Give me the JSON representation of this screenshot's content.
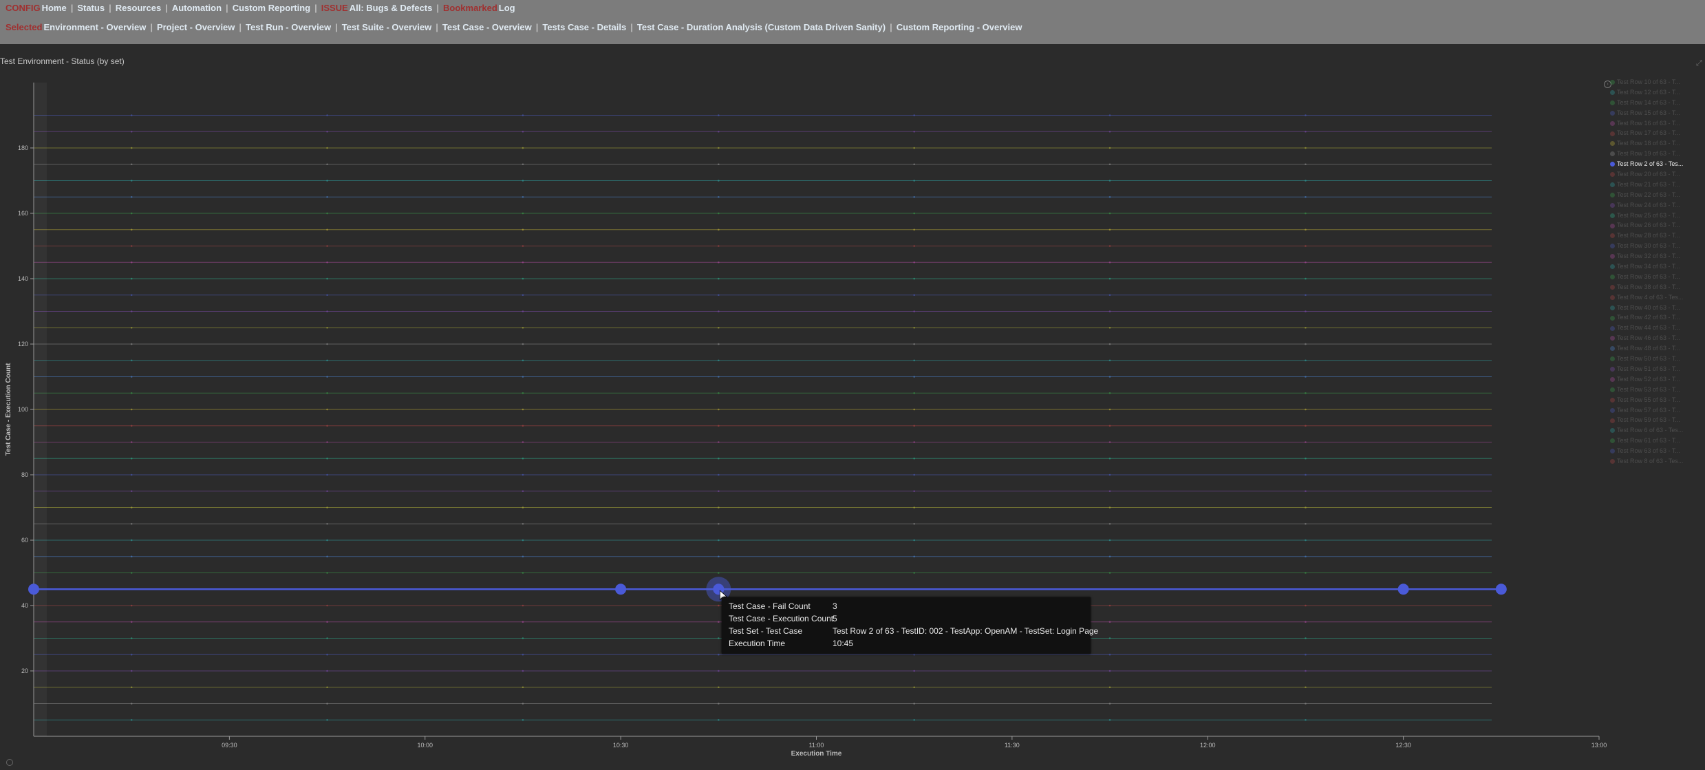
{
  "nav": {
    "row1": [
      {
        "tag": "CONFIG",
        "label": "Home"
      },
      {
        "label": "Status"
      },
      {
        "label": "Resources"
      },
      {
        "label": "Automation"
      },
      {
        "label": "Custom Reporting"
      },
      {
        "tag": "ISSUE",
        "label": "All: Bugs & Defects"
      },
      {
        "tag": "Bookmarked",
        "label": "Log"
      }
    ],
    "row2": [
      {
        "tag": "Selected",
        "label": "Environment - Overview"
      },
      {
        "label": "Project - Overview"
      },
      {
        "label": "Test Run - Overview"
      },
      {
        "label": "Test Suite - Overview"
      },
      {
        "label": "Test Case - Overview"
      },
      {
        "label": "Tests Case - Details"
      },
      {
        "label": "Test Case - Duration Analysis (Custom  Data Driven  Sanity)"
      },
      {
        "label": "Custom Reporting - Overview"
      }
    ]
  },
  "tooltip": {
    "rows": [
      {
        "key": "Test Case - Fail Count",
        "value": "3"
      },
      {
        "key": "Test Case - Execution Count",
        "value": "5"
      },
      {
        "key": "Test Set - Test Case",
        "value": "Test Row 2 of 63 - TestID: 002 - TestApp: OpenAM - TestSet: Login Page"
      },
      {
        "key": "Execution Time",
        "value": "10:45"
      }
    ]
  },
  "chart_data": {
    "type": "line",
    "title": "Test Environment - Status (by set)",
    "xlabel": "Execution Time",
    "ylabel": "Test Case - Execution Count",
    "x_ticks": [
      "09:30",
      "10:00",
      "10:30",
      "11:00",
      "11:30",
      "12:00",
      "12:30",
      "13:00"
    ],
    "x_range": [
      "09:00",
      "13:00"
    ],
    "y_ticks": [
      20,
      40,
      60,
      80,
      100,
      120,
      140,
      160,
      180
    ],
    "ylim": [
      0,
      200
    ],
    "grid": false,
    "legend_position": "right",
    "highlighted_series": "Test Row 2 of 63 - Tes...",
    "highlighted_series_points": {
      "x": [
        "09:00",
        "10:30",
        "10:45",
        "12:30",
        "12:45"
      ],
      "y": [
        45,
        45,
        45,
        45,
        45
      ]
    },
    "background_series_levels": [
      5,
      10,
      15,
      20,
      25,
      30,
      35,
      40,
      45,
      50,
      55,
      60,
      65,
      70,
      75,
      80,
      85,
      90,
      95,
      100,
      105,
      110,
      115,
      120,
      125,
      130,
      135,
      140,
      145,
      150,
      155,
      160,
      165,
      170,
      175,
      180,
      185,
      190
    ],
    "series_colors": [
      "#2e9c9c",
      "#8a8a8a",
      "#a8a838",
      "#7a4aa8",
      "#4a5ab8",
      "#2ea888",
      "#a84a9a",
      "#a84444",
      "#b8a838",
      "#3a9a4a",
      "#4a80c8"
    ],
    "legend": [
      {
        "label": "Test Row 10 of 63 - T...",
        "color": "#3a9a4a"
      },
      {
        "label": "Test Row 12 of 63 - T...",
        "color": "#2e9c9c"
      },
      {
        "label": "Test Row 14 of 63 - T...",
        "color": "#3a9a4a"
      },
      {
        "label": "Test Row 15 of 63 - T...",
        "color": "#4a5ab8"
      },
      {
        "label": "Test Row 16 of 63 - T...",
        "color": "#a84a9a"
      },
      {
        "label": "Test Row 17 of 63 - T...",
        "color": "#a84444"
      },
      {
        "label": "Test Row 18 of 63 - T...",
        "color": "#b8a838"
      },
      {
        "label": "Test Row 19 of 63 - T...",
        "color": "#8a8a8a"
      },
      {
        "label": "Test Row 2 of 63 - Tes...",
        "color": "#4a5ad8"
      },
      {
        "label": "Test Row 20 of 63 - T...",
        "color": "#a84444"
      },
      {
        "label": "Test Row 21 of 63 - T...",
        "color": "#2e9c9c"
      },
      {
        "label": "Test Row 22 of 63 - T...",
        "color": "#3a9a4a"
      },
      {
        "label": "Test Row 24 of 63 - T...",
        "color": "#7a4aa8"
      },
      {
        "label": "Test Row 25 of 63 - T...",
        "color": "#2ea888"
      },
      {
        "label": "Test Row 26 of 63 - T...",
        "color": "#a84a9a"
      },
      {
        "label": "Test Row 28 of 63 - T...",
        "color": "#a84444"
      },
      {
        "label": "Test Row 30 of 63 - T...",
        "color": "#4a5ab8"
      },
      {
        "label": "Test Row 32 of 63 - T...",
        "color": "#a84a9a"
      },
      {
        "label": "Test Row 34 of 63 - T...",
        "color": "#2e9c9c"
      },
      {
        "label": "Test Row 36 of 63 - T...",
        "color": "#3a9a4a"
      },
      {
        "label": "Test Row 38 of 63 - T...",
        "color": "#a84444"
      },
      {
        "label": "Test Row 4 of 63 - Tes...",
        "color": "#a84444"
      },
      {
        "label": "Test Row 40 of 63 - T...",
        "color": "#2e9c9c"
      },
      {
        "label": "Test Row 42 of 63 - T...",
        "color": "#3a9a4a"
      },
      {
        "label": "Test Row 44 of 63 - T...",
        "color": "#4a5ab8"
      },
      {
        "label": "Test Row 46 of 63 - T...",
        "color": "#a84a9a"
      },
      {
        "label": "Test Row 48 of 63 - T...",
        "color": "#4a80c8"
      },
      {
        "label": "Test Row 50 of 63 - T...",
        "color": "#3a9a4a"
      },
      {
        "label": "Test Row 51 of 63 - T...",
        "color": "#7a4aa8"
      },
      {
        "label": "Test Row 52 of 63 - T...",
        "color": "#a84a9a"
      },
      {
        "label": "Test Row 53 of 63 - T...",
        "color": "#3a9a4a"
      },
      {
        "label": "Test Row 55 of 63 - T...",
        "color": "#a84444"
      },
      {
        "label": "Test Row 57 of 63 - T...",
        "color": "#4a5ab8"
      },
      {
        "label": "Test Row 59 of 63 - T...",
        "color": "#a84444"
      },
      {
        "label": "Test Row 6 of 63 - Tes...",
        "color": "#2e9c9c"
      },
      {
        "label": "Test Row 61 of 63 - T...",
        "color": "#3a9a4a"
      },
      {
        "label": "Test Row 63 of 63 - T...",
        "color": "#4a5ab8"
      },
      {
        "label": "Test Row 8 of 63 - Tes...",
        "color": "#a84444"
      }
    ]
  }
}
